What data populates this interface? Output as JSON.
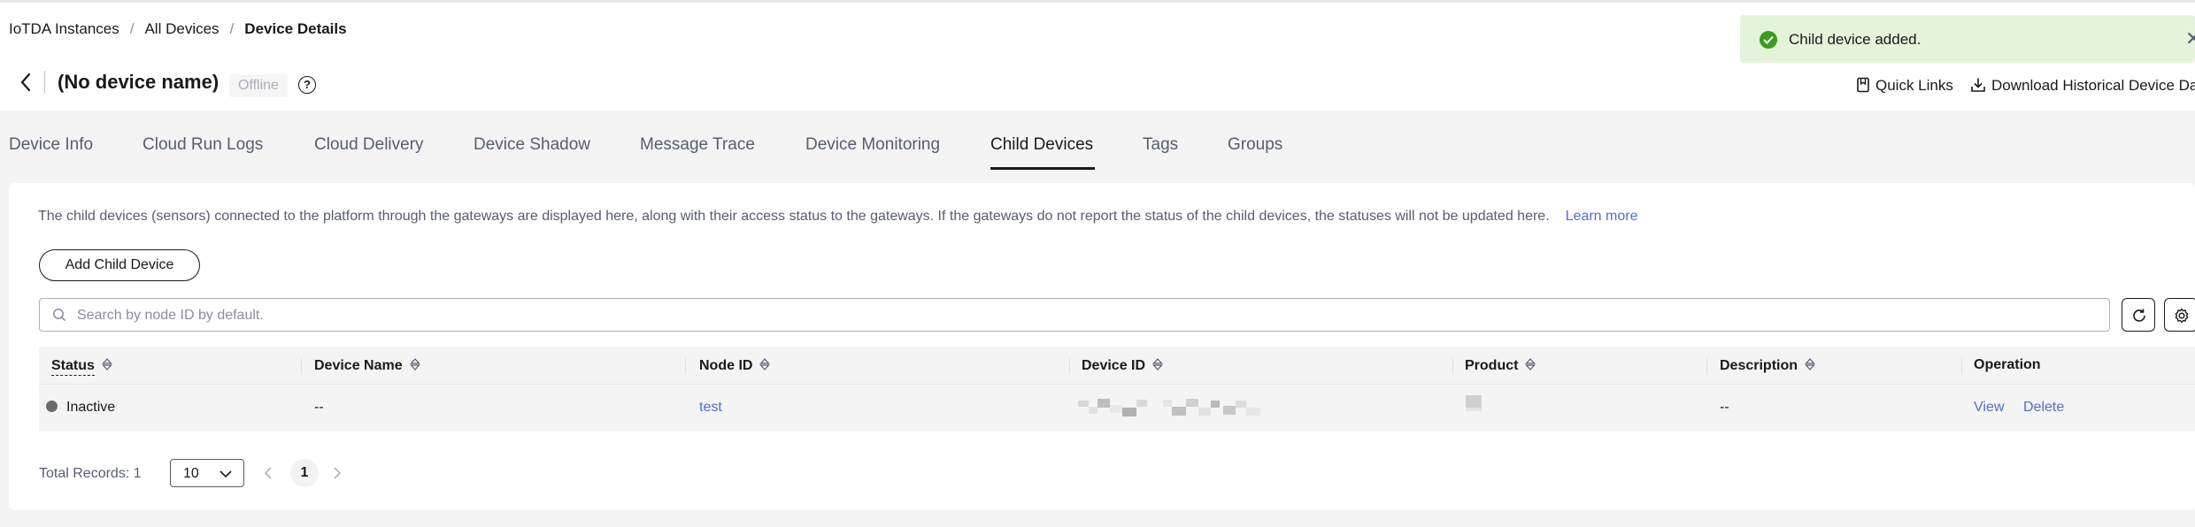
{
  "breadcrumb": {
    "items": [
      "IoTDA Instances",
      "All Devices"
    ],
    "current": "Device Details"
  },
  "header": {
    "title": "(No device name)",
    "status": "Offline",
    "help_icon": "help-circle-icon",
    "quick_links_label": "Quick Links",
    "download_label": "Download Historical Device Da"
  },
  "toast": {
    "message": "Child device added.",
    "icon": "check-circle-icon",
    "color": "#e4f4da"
  },
  "tabs": [
    {
      "label": "Device Info"
    },
    {
      "label": "Cloud Run Logs"
    },
    {
      "label": "Cloud Delivery"
    },
    {
      "label": "Device Shadow"
    },
    {
      "label": "Message Trace"
    },
    {
      "label": "Device Monitoring"
    },
    {
      "label": "Child Devices"
    },
    {
      "label": "Tags"
    },
    {
      "label": "Groups"
    }
  ],
  "active_tab": "Child Devices",
  "child_devices": {
    "description": "The child devices (sensors) connected to the platform through the gateways are displayed here, along with their access status to the gateways. If the gateways do not report the status of the child devices, the statuses will not be updated here.",
    "learn_more": "Learn more",
    "add_button": "Add Child Device",
    "search_placeholder": "Search by node ID by default.",
    "columns": [
      "Status",
      "Device Name",
      "Node ID",
      "Device ID",
      "Product",
      "Description",
      "Operation"
    ],
    "rows": [
      {
        "status": "Inactive",
        "device_name": "--",
        "node_id": "test",
        "device_id": "",
        "product": "",
        "description": "--",
        "actions": [
          "View",
          "Delete"
        ]
      }
    ],
    "pagination": {
      "total_label": "Total Records: 1",
      "page_size": "10",
      "current_page": "1"
    }
  },
  "colors": {
    "link": "#526ecc",
    "toast_success": "#3a9e1c",
    "page_bg": "#f4f4f5"
  }
}
